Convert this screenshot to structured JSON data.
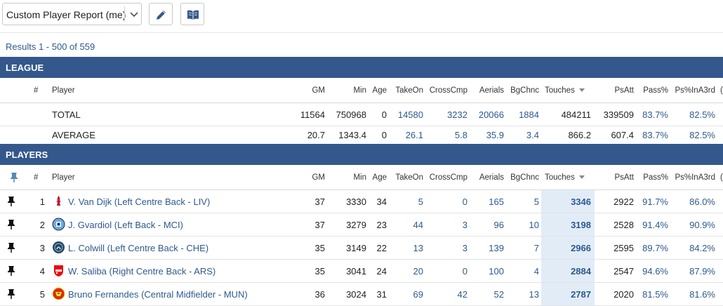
{
  "toolbar": {
    "report_select": "Custom Player Report (me)",
    "edit_icon": "pencil-icon",
    "book_icon": "book-icon"
  },
  "results_text": "Results 1 - 500 of 559",
  "columns": {
    "rank": "#",
    "player": "Player",
    "gm": "GM",
    "min": "Min",
    "age": "Age",
    "takeon": "TakeOn",
    "crosscmp": "CrossCmp",
    "aerials": "Aerials",
    "bgchnc": "BgChnc",
    "touches": "Touches",
    "psatt": "PsAtt",
    "passpct": "Pass%",
    "psina3rd": "Ps%InA3rd",
    "extra": "("
  },
  "league": {
    "title": "LEAGUE",
    "rows": [
      {
        "label": "TOTAL",
        "gm": "11564",
        "min": "750968",
        "age": "0",
        "takeon": "14580",
        "crosscmp": "3232",
        "aerials": "20066",
        "bgchnc": "1884",
        "touches": "484211",
        "psatt": "339509",
        "passpct": "83.7%",
        "psina3rd": "82.5%"
      },
      {
        "label": "AVERAGE",
        "gm": "20.7",
        "min": "1343.4",
        "age": "0",
        "takeon": "26.1",
        "crosscmp": "5.8",
        "aerials": "35.9",
        "bgchnc": "3.4",
        "touches": "866.2",
        "psatt": "607.4",
        "passpct": "83.7%",
        "psina3rd": "82.5%"
      }
    ]
  },
  "players": {
    "title": "PLAYERS",
    "rows": [
      {
        "rank": "1",
        "name": "V. Van Dijk (Left Centre Back - LIV)",
        "crest": "liverpool-crest",
        "gm": "37",
        "min": "3330",
        "age": "34",
        "takeon": "5",
        "crosscmp": "0",
        "aerials": "165",
        "bgchnc": "5",
        "touches": "3346",
        "psatt": "2922",
        "passpct": "91.7%",
        "psina3rd": "86.0%"
      },
      {
        "rank": "2",
        "name": "J. Gvardiol (Left Back - MCI)",
        "crest": "man-city-crest",
        "gm": "37",
        "min": "3279",
        "age": "23",
        "takeon": "44",
        "crosscmp": "3",
        "aerials": "96",
        "bgchnc": "10",
        "touches": "3198",
        "psatt": "2528",
        "passpct": "91.4%",
        "psina3rd": "90.9%"
      },
      {
        "rank": "3",
        "name": "L. Colwill (Left Centre Back - CHE)",
        "crest": "chelsea-crest",
        "gm": "35",
        "min": "3149",
        "age": "22",
        "takeon": "13",
        "crosscmp": "3",
        "aerials": "139",
        "bgchnc": "7",
        "touches": "2966",
        "psatt": "2595",
        "passpct": "89.7%",
        "psina3rd": "84.2%"
      },
      {
        "rank": "4",
        "name": "W. Saliba (Right Centre Back - ARS)",
        "crest": "arsenal-crest",
        "gm": "35",
        "min": "3041",
        "age": "24",
        "takeon": "20",
        "crosscmp": "0",
        "aerials": "100",
        "bgchnc": "4",
        "touches": "2884",
        "psatt": "2547",
        "passpct": "94.6%",
        "psina3rd": "87.9%"
      },
      {
        "rank": "5",
        "name": "Bruno Fernandes (Central Midfielder - MUN)",
        "crest": "man-united-crest",
        "gm": "36",
        "min": "3024",
        "age": "31",
        "takeon": "69",
        "crosscmp": "42",
        "aerials": "52",
        "bgchnc": "13",
        "touches": "2787",
        "psatt": "2020",
        "passpct": "81.5%",
        "psina3rd": "81.6%"
      }
    ]
  },
  "colors": {
    "band": "#34588c",
    "link": "#2d5a8e",
    "sorted_column": "#e2ecf7",
    "liverpool": "#c8102e",
    "man_city": "#6cabdd",
    "chelsea": "#034694",
    "arsenal": "#ef0107",
    "man_united": "#da291c"
  }
}
